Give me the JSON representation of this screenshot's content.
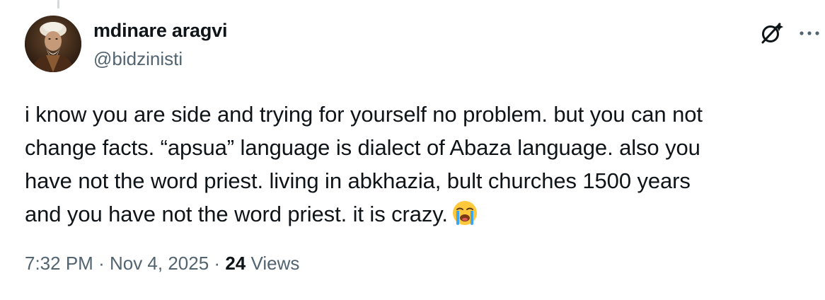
{
  "tweet": {
    "author": {
      "name": "mdinare aragvi",
      "handle": "@bidzinisti",
      "avatar_icon": "portrait-avatar"
    },
    "text_lines": [
      "i know you are side and trying for yourself no problem. but you can not",
      "change facts. “apsua” language is dialect of Abaza language. also you",
      "have not the word priest. living in abkhazia, bult churches 1500 years",
      "and you have not the word priest. it is crazy."
    ],
    "emoji": "loudly-crying-face",
    "meta": {
      "time": "7:32 PM",
      "separator": "·",
      "date": "Nov 4, 2025",
      "views_count": "24",
      "views_label": "Views"
    },
    "actions": {
      "grok_icon": "grok-icon",
      "more_icon": "more-options-icon"
    }
  },
  "colors": {
    "primary_text": "#0f1419",
    "secondary_text": "#536471",
    "thread_line": "#cfd9de"
  }
}
